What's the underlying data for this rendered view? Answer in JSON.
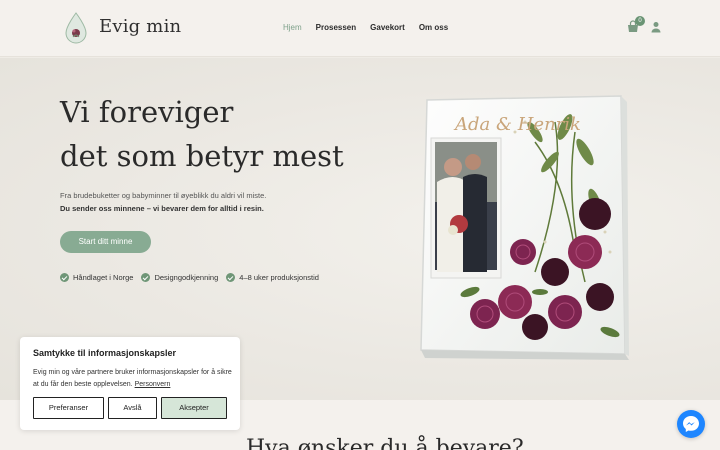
{
  "brand": {
    "name": "Evig min"
  },
  "nav": {
    "items": [
      {
        "label": "Hjem",
        "active": true
      },
      {
        "label": "Prosessen",
        "active": false
      },
      {
        "label": "Gavekort",
        "active": false
      },
      {
        "label": "Om oss",
        "active": false
      }
    ]
  },
  "cart": {
    "count": "0",
    "icon": "cart-icon"
  },
  "user": {
    "icon": "user-icon"
  },
  "hero": {
    "title_line1": "Vi foreviger",
    "title_line2": "det som betyr mest",
    "subtitle": "Fra brudebuketter og babyminner til øyeblikk du aldri vil miste.",
    "subtitle_bold": "Du sender oss minnene – vi bevarer dem for alltid i resin.",
    "cta_label": "Start ditt minne",
    "features": [
      "Håndlaget i Norge",
      "Designgodkjenning",
      "4–8 uker produksjonstid"
    ],
    "product_script": "Ada & Henrik"
  },
  "cookie": {
    "title": "Samtykke til informasjonskapsler",
    "text": "Evig min og våre partnere bruker informasjonskapsler for å sikre at du får den beste opplevelsen.",
    "link": "Personvern",
    "buttons": {
      "preferences": "Preferanser",
      "decline": "Avslå",
      "accept": "Aksepter"
    }
  },
  "section": {
    "heading": "Hva ønsker du å bevare?"
  },
  "colors": {
    "accent": "#88ab93",
    "accent_dark": "#6f9677",
    "background": "#efece6",
    "messenger": "#1e86ff"
  }
}
